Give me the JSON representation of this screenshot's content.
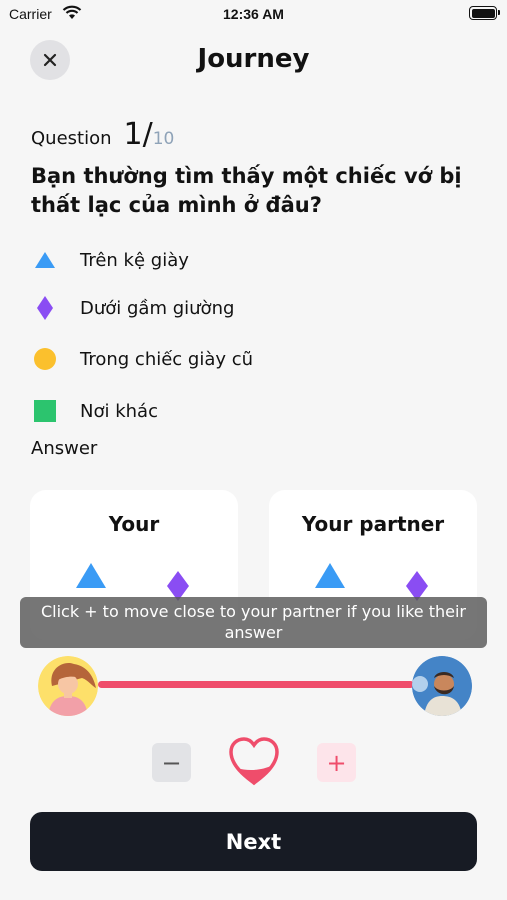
{
  "status_bar": {
    "carrier": "Carrier",
    "time": "12:36 AM"
  },
  "header": {
    "title": "Journey"
  },
  "question": {
    "label": "Question",
    "current": "1",
    "slash": "/",
    "total": "10",
    "text": "Bạn thường tìm thấy một chiếc vớ bị thất lạc của mình ở đâu?"
  },
  "options": [
    {
      "label": "Trên kệ giày",
      "icon": "blue-triangle-icon",
      "color": "#3a9bf5"
    },
    {
      "label": "Dưới gầm giường",
      "icon": "purple-diamond-icon",
      "color": "#8a4df3"
    },
    {
      "label": "Trong chiếc giày cũ",
      "icon": "yellow-circle-icon",
      "color": "#fbc02d"
    },
    {
      "label": "Nơi khác",
      "icon": "green-square-icon",
      "color": "#2cc46e"
    }
  ],
  "answer_label": "Answer",
  "cards": {
    "your": {
      "title": "Your"
    },
    "partner": {
      "title": "Your partner"
    }
  },
  "tooltip": {
    "text": "Click + to move close to your partner if you like their answer"
  },
  "controls": {
    "minus": "−",
    "plus": "+"
  },
  "next_button": {
    "label": "Next"
  },
  "colors": {
    "accent": "#ef4d6b",
    "dark": "#171b24"
  }
}
